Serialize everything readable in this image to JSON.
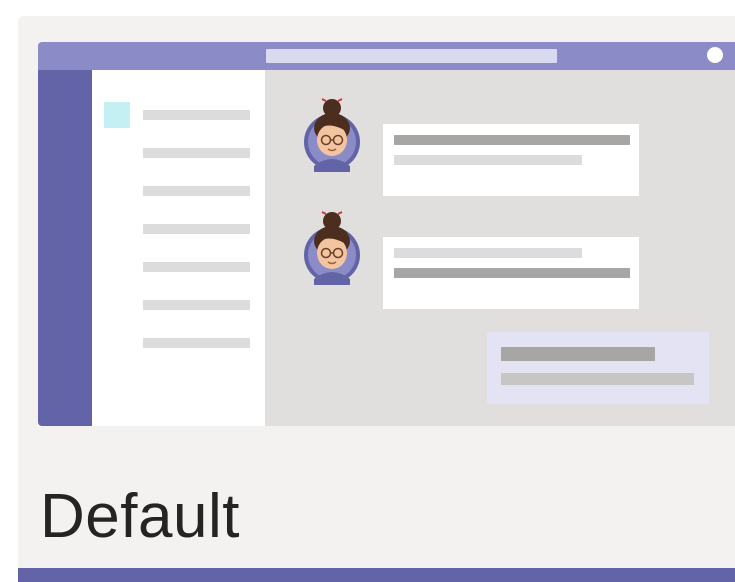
{
  "theme_option": {
    "label": "Default",
    "selected": true
  },
  "colors": {
    "brand": "#6264a7",
    "titlebar": "#8b8cc7",
    "card_background": "#f3f2f1",
    "chat_background": "#e1dfdd",
    "list_selection": "#c4f0f3",
    "reply_bubble": "#e3e3f3"
  },
  "preview": {
    "list_line_count": 7,
    "messages": [
      {
        "avatar": "avatar-woman-with-glasses-icon"
      },
      {
        "avatar": "avatar-woman-with-glasses-icon"
      }
    ]
  }
}
